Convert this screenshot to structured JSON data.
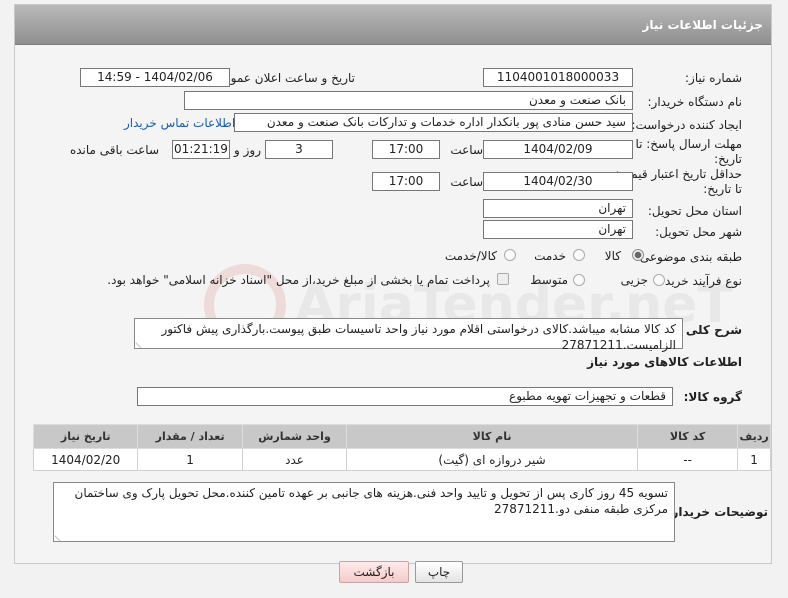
{
  "header": {
    "title": "جزئیات اطلاعات نیاز"
  },
  "fields": {
    "need_number_label": "شماره نیاز:",
    "need_number": "1104001018000033",
    "announce_label": "تاریخ و ساعت اعلان عمومی:",
    "announce_value": "1404/02/06 - 14:59",
    "buyer_org_label": "نام دستگاه خریدار:",
    "buyer_org": "بانک صنعت و معدن",
    "creator_label": "ایجاد کننده درخواست:",
    "creator": "سید حسن منادی پور بانکدار اداره خدمات و تدارکات بانک صنعت و معدن",
    "contact_link": "اطلاعات تماس خریدار",
    "deadline_label_1": "مهلت ارسال پاسخ: تا",
    "deadline_label_2": "تاریخ:",
    "deadline_date": "1404/02/09",
    "time_label": "ساعت",
    "deadline_time": "17:00",
    "days_value": "3",
    "days_label": "روز و",
    "remaining_time": "01:21:19",
    "remaining_label": "ساعت باقی مانده",
    "price_validity_label_1": "حداقل تاریخ اعتبار قیمت:",
    "price_validity_label_2": "تا تاریخ:",
    "price_validity_date": "1404/02/30",
    "price_validity_time": "17:00",
    "province_label": "استان محل تحویل:",
    "province": "تهران",
    "city_label": "شهر محل تحویل:",
    "city": "تهران",
    "category_label": "طبقه بندی موضوعی:",
    "category_options": [
      "کالا",
      "خدمت",
      "کالا/خدمت"
    ],
    "process_label": "نوع فرآیند خرید :",
    "process_options": [
      "جزیی",
      "متوسط"
    ],
    "payment_note": "پرداخت تمام یا بخشی از مبلغ خرید،از محل \"اسناد خزانه اسلامی\" خواهد بود."
  },
  "description": {
    "label": "شرح کلی نیاز:",
    "text": "کد کالا مشابه میباشد.کالای درخواستی اقلام مورد نیاز واحد تاسیسات طبق پیوست.بارگذاری پیش فاکتور الزامیست.27871211"
  },
  "goods_info": {
    "title": "اطلاعات کالاهای مورد نیاز",
    "group_label": "گروه کالا:",
    "group_value": "قطعات و تجهیزات تهویه مطبوع"
  },
  "table": {
    "headers": [
      "ردیف",
      "کد کالا",
      "نام کالا",
      "واحد شمارش",
      "تعداد / مقدار",
      "تاریخ نیاز"
    ],
    "rows": [
      [
        "1",
        "--",
        "شیر دروازه ای (گیت)",
        "عدد",
        "1",
        "1404/02/20"
      ]
    ]
  },
  "buyer_notes": {
    "label": "توضیحات خریدار:",
    "text": "تسویه 45 روز کاری پس از تحویل و تایید واحد فنی.هزینه های جانبی بر عهده تامین کننده.محل تحویل پارک وی ساختمان مرکزی طبقه منفی دو.27871211"
  },
  "buttons": {
    "print": "چاپ",
    "back": "بازگشت"
  },
  "watermark": {
    "text": "AriaTender.neT"
  },
  "colors": {
    "header": "#9e9e9e",
    "link": "#1a5bb3",
    "back_button": "#f3cccc"
  }
}
